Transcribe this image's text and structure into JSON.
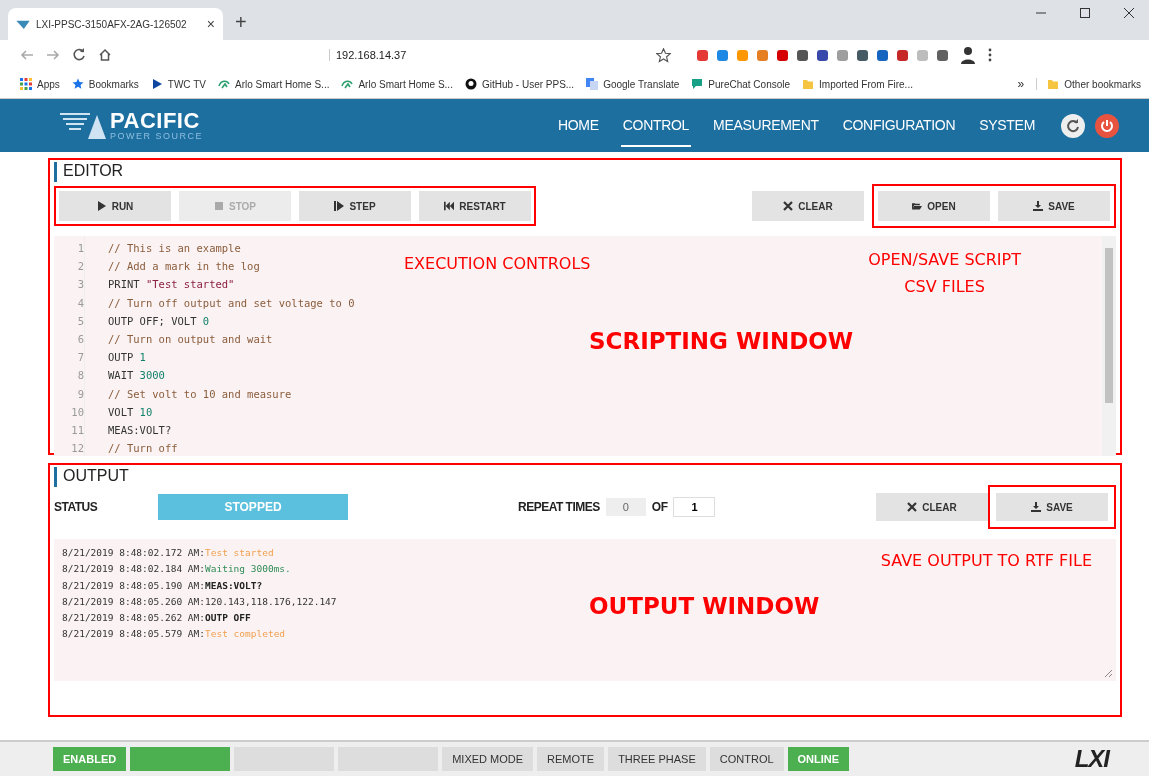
{
  "browser": {
    "tab_title": "LXI-PPSC-3150AFX-2AG-126502",
    "tab_close": "×",
    "new_tab": "+",
    "url": "192.168.14.37",
    "bookmarks": [
      {
        "label": "Apps",
        "kind": "apps"
      },
      {
        "label": "Bookmarks",
        "kind": "star"
      },
      {
        "label": "TWC TV",
        "kind": "play"
      },
      {
        "label": "Arlo Smart Home S...",
        "kind": "arlo"
      },
      {
        "label": "Arlo Smart Home S...",
        "kind": "arlo"
      },
      {
        "label": "GitHub - User PPS...",
        "kind": "github"
      },
      {
        "label": "Google Translate",
        "kind": "translate"
      },
      {
        "label": "PureChat Console",
        "kind": "chat"
      },
      {
        "label": "Imported From Fire...",
        "kind": "folder"
      }
    ],
    "overflow": "»",
    "other_bookmarks": "Other bookmarks"
  },
  "header": {
    "logo": "PACIFIC",
    "logo_sub": "POWER SOURCE",
    "nav": [
      {
        "label": "HOME",
        "selected": false
      },
      {
        "label": "CONTROL",
        "selected": true
      },
      {
        "label": "MEASUREMENT",
        "selected": false
      },
      {
        "label": "CONFIGURATION",
        "selected": false
      },
      {
        "label": "SYSTEM",
        "selected": false
      }
    ]
  },
  "editor": {
    "title": "EDITOR",
    "left_buttons": [
      {
        "label": "RUN",
        "kind": "play",
        "disabled": false
      },
      {
        "label": "STOP",
        "kind": "stop",
        "disabled": true
      },
      {
        "label": "STEP",
        "kind": "step",
        "disabled": false
      },
      {
        "label": "RESTART",
        "kind": "restart",
        "disabled": false
      }
    ],
    "right_buttons": [
      {
        "label": "CLEAR",
        "kind": "clear",
        "disabled": false
      },
      {
        "label": "OPEN",
        "kind": "open",
        "disabled": false
      },
      {
        "label": "SAVE",
        "kind": "save",
        "disabled": false
      }
    ],
    "lines": [
      {
        "n": "1",
        "tokens": [
          {
            "t": "// This is an example",
            "kind": "comment"
          }
        ]
      },
      {
        "n": "2",
        "tokens": [
          {
            "t": "// Add a mark in the log",
            "kind": "comment"
          }
        ]
      },
      {
        "n": "3",
        "tokens": [
          {
            "t": "PRINT ",
            "kind": "cmd"
          },
          {
            "t": "\"Test started\"",
            "kind": "string"
          }
        ]
      },
      {
        "n": "4",
        "tokens": [
          {
            "t": "// Turn off output and set voltage to 0",
            "kind": "comment"
          }
        ]
      },
      {
        "n": "5",
        "tokens": [
          {
            "t": "OUTP OFF; VOLT ",
            "kind": "cmd"
          },
          {
            "t": "0",
            "kind": "num"
          }
        ]
      },
      {
        "n": "6",
        "tokens": [
          {
            "t": "// Turn on output and wait",
            "kind": "comment"
          }
        ]
      },
      {
        "n": "7",
        "tokens": [
          {
            "t": "OUTP ",
            "kind": "cmd"
          },
          {
            "t": "1",
            "kind": "num"
          }
        ]
      },
      {
        "n": "8",
        "tokens": [
          {
            "t": "WAIT ",
            "kind": "cmd"
          },
          {
            "t": "3000",
            "kind": "num"
          }
        ]
      },
      {
        "n": "9",
        "tokens": [
          {
            "t": "// Set volt to 10 and measure",
            "kind": "comment"
          }
        ]
      },
      {
        "n": "10",
        "tokens": [
          {
            "t": "VOLT ",
            "kind": "cmd"
          },
          {
            "t": "10",
            "kind": "num"
          }
        ]
      },
      {
        "n": "11",
        "tokens": [
          {
            "t": "MEAS:VOLT?",
            "kind": "cmd"
          }
        ]
      },
      {
        "n": "12",
        "tokens": [
          {
            "t": "// Turn off",
            "kind": "comment"
          }
        ]
      }
    ]
  },
  "output": {
    "title": "OUTPUT",
    "status_label": "STATUS",
    "status": "STOPPED",
    "repeat_label": "REPEAT TIMES",
    "repeat_done": "0",
    "of_label": "OF",
    "repeat_total": "1",
    "buttons": [
      {
        "label": "CLEAR",
        "kind": "clear",
        "disabled": false
      },
      {
        "label": "SAVE",
        "kind": "save",
        "disabled": false
      }
    ],
    "log": [
      {
        "time": "8/21/2019 8:48:02.172 AM:",
        "message": "Test started",
        "kind": "print"
      },
      {
        "time": "8/21/2019 8:48:02.184 AM:",
        "message": "Waiting 3000ms.",
        "kind": "wait"
      },
      {
        "time": "8/21/2019 8:48:05.190 AM:",
        "message": "MEAS:VOLT?",
        "kind": "command"
      },
      {
        "time": "8/21/2019 8:48:05.260 AM:",
        "message": "120.143,118.176,122.147",
        "kind": "data"
      },
      {
        "time": "8/21/2019 8:48:05.262 AM:",
        "message": "OUTP OFF",
        "kind": "command"
      },
      {
        "time": "8/21/2019 8:48:05.579 AM:",
        "message": "Test completed",
        "kind": "print"
      }
    ]
  },
  "annotations": {
    "execution_controls": "EXECUTION CONTROLS",
    "open_save": "OPEN/SAVE SCRIPT",
    "open_save_2": "CSV FILES",
    "scripting_window": "SCRIPTING WINDOW",
    "save_output": "SAVE OUTPUT TO RTF FILE",
    "output_window": "OUTPUT WINDOW"
  },
  "status_bar": {
    "items": [
      {
        "label": "ENABLED",
        "on": true
      },
      {
        "on": true
      },
      {
        "on": false
      },
      {
        "on": false
      },
      {
        "label": "MIXED MODE",
        "on": false
      },
      {
        "label": "REMOTE",
        "on": false
      },
      {
        "label": "THREE PHASE",
        "on": false
      },
      {
        "label": "CONTROL",
        "on": false
      },
      {
        "label": "ONLINE",
        "on": true
      }
    ],
    "logo": "LXI"
  }
}
